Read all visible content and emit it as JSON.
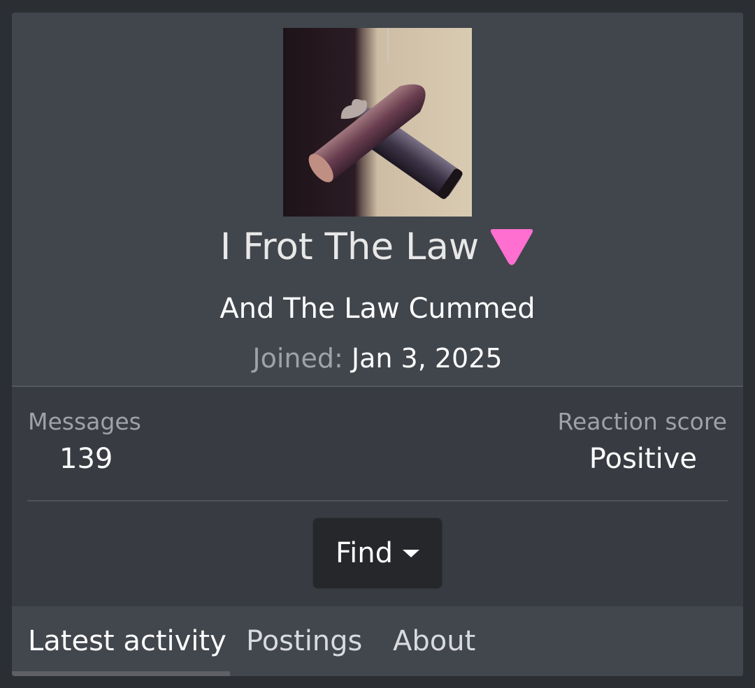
{
  "profile": {
    "avatar_icon": "user-avatar-image",
    "username": "I Frot The Law",
    "flair_icon": "pink-down-triangle-icon",
    "flair_color": "#ff6fd0",
    "user_title": "And The Law Cummed",
    "joined_label": "Joined:",
    "joined_date": "Jan 3, 2025"
  },
  "stats": {
    "messages_label": "Messages",
    "messages_value": "139",
    "reaction_label": "Reaction score",
    "reaction_value": "Positive"
  },
  "actions": {
    "find_label": "Find",
    "find_icon": "caret-down-icon"
  },
  "tabs": [
    {
      "label": "Latest activity",
      "active": true
    },
    {
      "label": "Postings",
      "active": false
    },
    {
      "label": "About",
      "active": false
    }
  ],
  "colors": {
    "page_background": "#2b2e33",
    "card_background": "#383b41",
    "header_background": "#41454c",
    "button_background": "#25272b",
    "muted_text": "#9fa2a7"
  }
}
